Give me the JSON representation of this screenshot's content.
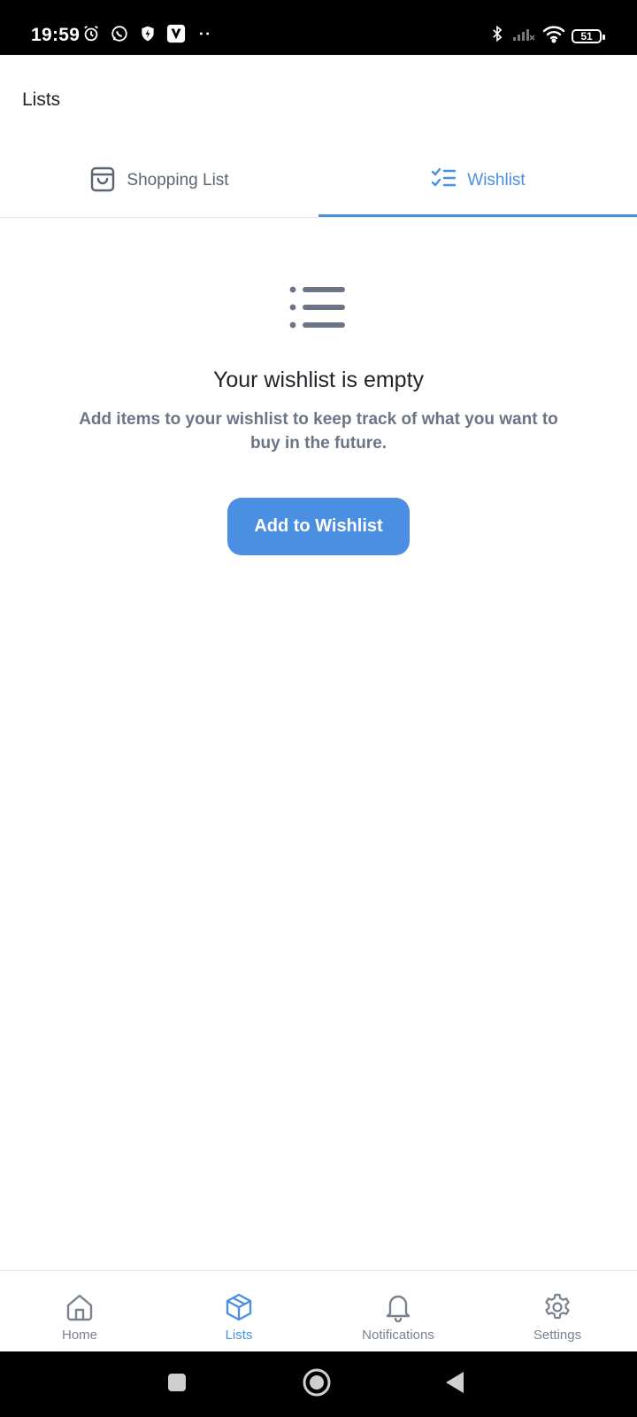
{
  "status_bar": {
    "time": "19:59",
    "battery": "51"
  },
  "header": {
    "title": "Lists"
  },
  "tabs": [
    {
      "label": "Shopping List",
      "icon": "shopping-bag-icon",
      "active": false
    },
    {
      "label": "Wishlist",
      "icon": "checklist-icon",
      "active": true
    }
  ],
  "empty_state": {
    "icon": "list-icon",
    "title": "Your wishlist is empty",
    "description": "Add items to your wishlist to keep track of what you want to buy in the future.",
    "button_label": "Add to Wishlist"
  },
  "bottom_nav": [
    {
      "label": "Home",
      "icon": "home-icon",
      "active": false
    },
    {
      "label": "Lists",
      "icon": "box-icon",
      "active": true
    },
    {
      "label": "Notifications",
      "icon": "bell-icon",
      "active": false
    },
    {
      "label": "Settings",
      "icon": "gear-icon",
      "active": false
    }
  ],
  "colors": {
    "accent": "#4a8fe2",
    "muted_text": "#6b7585",
    "inactive_nav": "#7a8290",
    "divider": "#e5e7eb"
  }
}
